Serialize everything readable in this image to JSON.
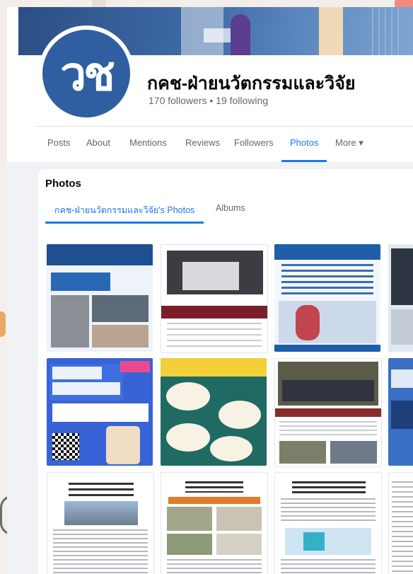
{
  "page": {
    "name": "กคช-ฝ่ายนวัตกรรมและวิจัย",
    "stats": "170 followers • 19 following",
    "avatar_text": "วช"
  },
  "tabs": [
    {
      "label": "Posts"
    },
    {
      "label": "About"
    },
    {
      "label": "Mentions"
    },
    {
      "label": "Reviews"
    },
    {
      "label": "Followers"
    },
    {
      "label": "Photos"
    },
    {
      "label": "More ▾"
    }
  ],
  "photos_section": {
    "title": "Photos",
    "sub_tabs": [
      {
        "label": "กคช-ฝ่ายนวัตกรรมและวิจัย's Photos"
      },
      {
        "label": "Albums"
      }
    ]
  },
  "colors": {
    "accent": "#1877f2",
    "brand_blue": "#2f5fa0"
  }
}
